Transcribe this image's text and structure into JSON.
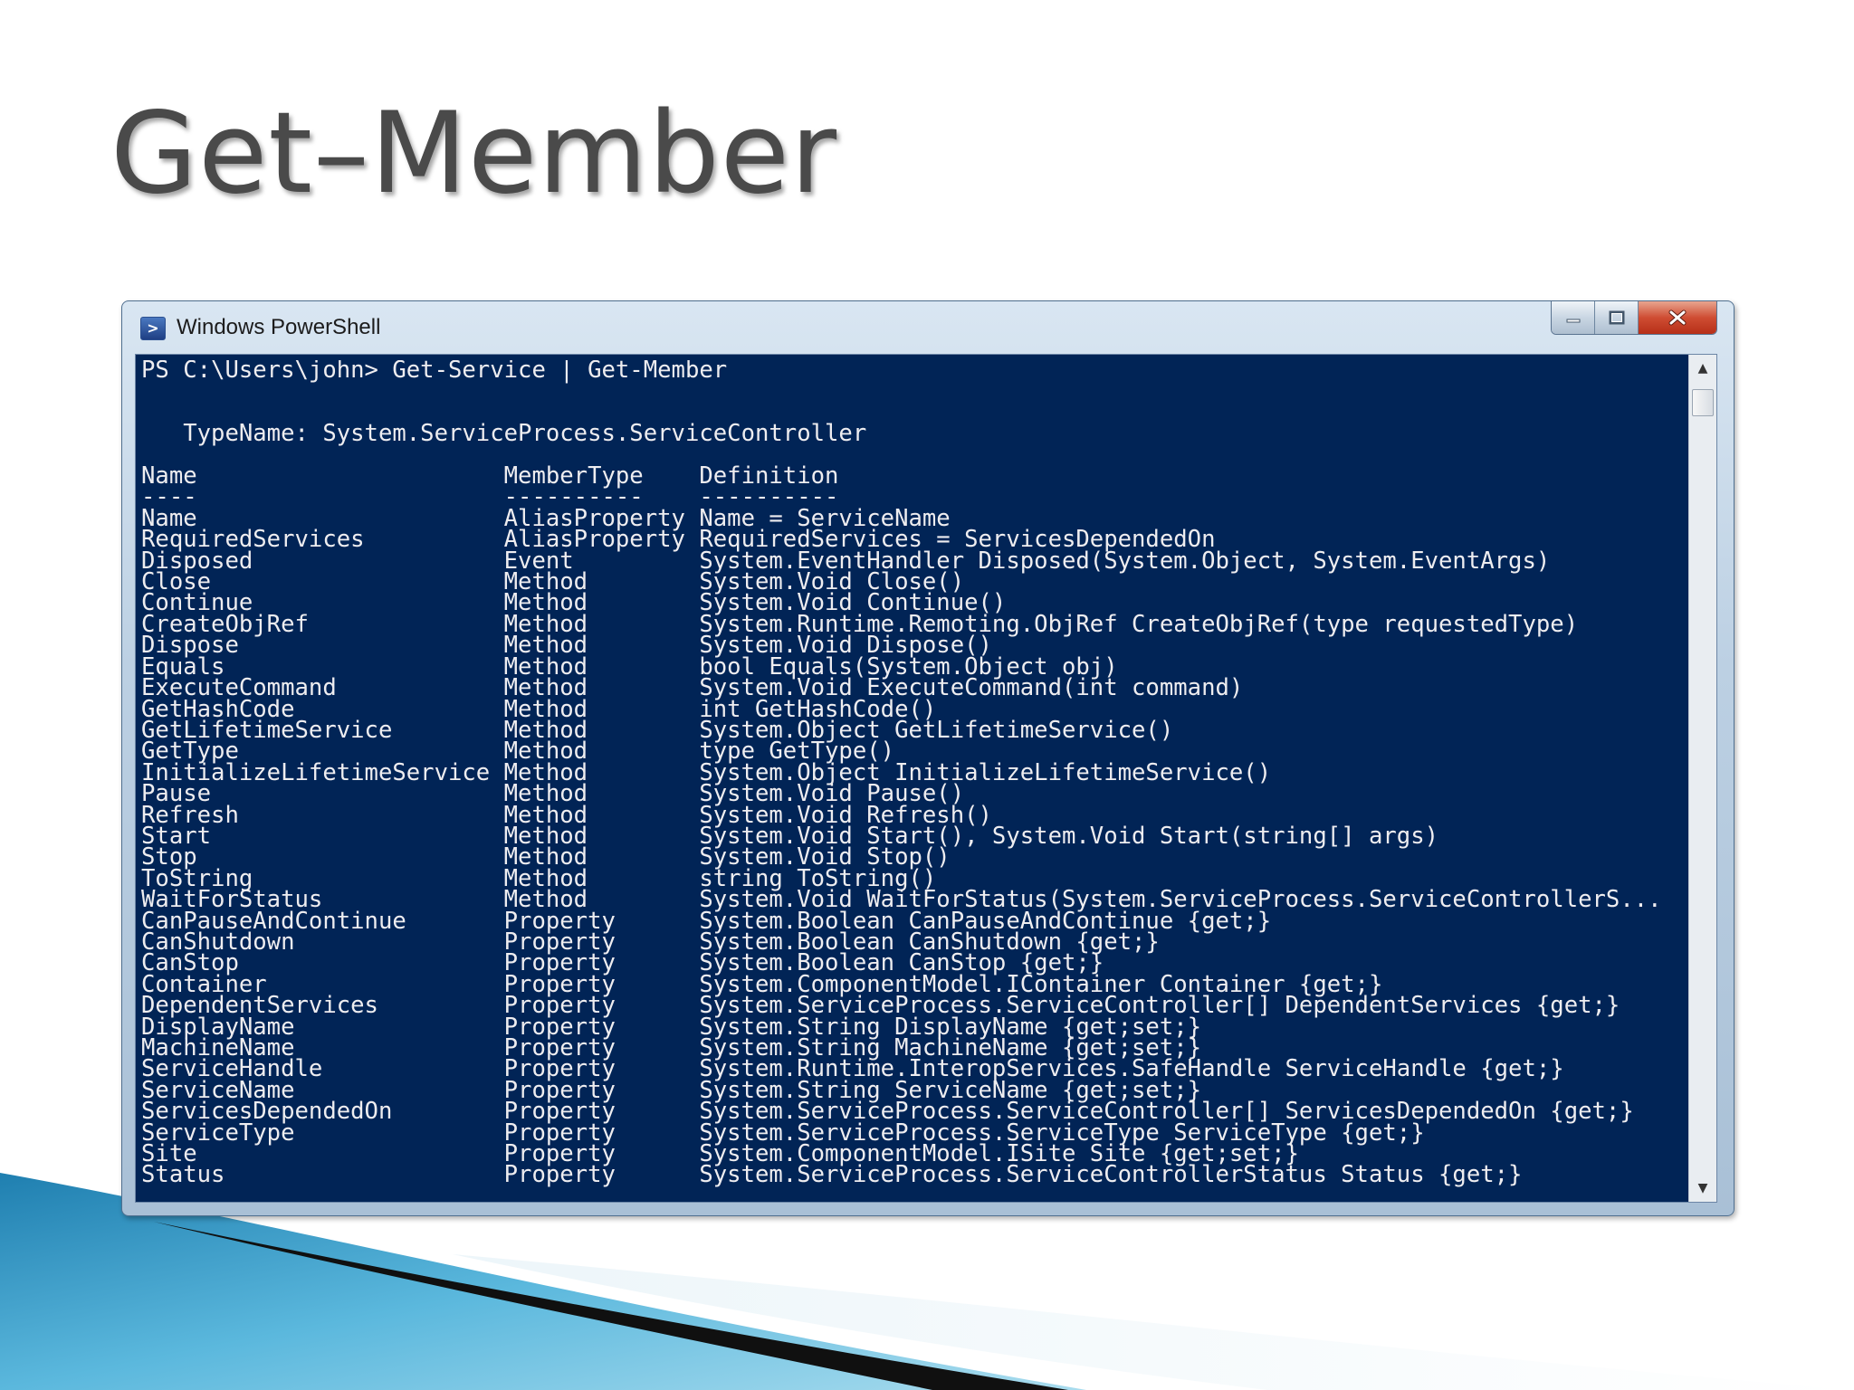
{
  "slide": {
    "title": "Get–Member"
  },
  "window": {
    "title": "Windows PowerShell",
    "icon_glyph": ">",
    "buttons": {
      "minimize": "–",
      "maximize": "□",
      "close": "x"
    }
  },
  "console": {
    "command_line": "PS C:\\Users\\john> Get-Service | Get-Member",
    "typename_line": "   TypeName: System.ServiceProcess.ServiceController",
    "columns": [
      "Name",
      "MemberType",
      "Definition"
    ],
    "rows": [
      [
        "Name",
        "AliasProperty",
        "Name = ServiceName"
      ],
      [
        "RequiredServices",
        "AliasProperty",
        "RequiredServices = ServicesDependedOn"
      ],
      [
        "Disposed",
        "Event",
        "System.EventHandler Disposed(System.Object, System.EventArgs)"
      ],
      [
        "Close",
        "Method",
        "System.Void Close()"
      ],
      [
        "Continue",
        "Method",
        "System.Void Continue()"
      ],
      [
        "CreateObjRef",
        "Method",
        "System.Runtime.Remoting.ObjRef CreateObjRef(type requestedType)"
      ],
      [
        "Dispose",
        "Method",
        "System.Void Dispose()"
      ],
      [
        "Equals",
        "Method",
        "bool Equals(System.Object obj)"
      ],
      [
        "ExecuteCommand",
        "Method",
        "System.Void ExecuteCommand(int command)"
      ],
      [
        "GetHashCode",
        "Method",
        "int GetHashCode()"
      ],
      [
        "GetLifetimeService",
        "Method",
        "System.Object GetLifetimeService()"
      ],
      [
        "GetType",
        "Method",
        "type GetType()"
      ],
      [
        "InitializeLifetimeService",
        "Method",
        "System.Object InitializeLifetimeService()"
      ],
      [
        "Pause",
        "Method",
        "System.Void Pause()"
      ],
      [
        "Refresh",
        "Method",
        "System.Void Refresh()"
      ],
      [
        "Start",
        "Method",
        "System.Void Start(), System.Void Start(string[] args)"
      ],
      [
        "Stop",
        "Method",
        "System.Void Stop()"
      ],
      [
        "ToString",
        "Method",
        "string ToString()"
      ],
      [
        "WaitForStatus",
        "Method",
        "System.Void WaitForStatus(System.ServiceProcess.ServiceControllerS..."
      ],
      [
        "CanPauseAndContinue",
        "Property",
        "System.Boolean CanPauseAndContinue {get;}"
      ],
      [
        "CanShutdown",
        "Property",
        "System.Boolean CanShutdown {get;}"
      ],
      [
        "CanStop",
        "Property",
        "System.Boolean CanStop {get;}"
      ],
      [
        "Container",
        "Property",
        "System.ComponentModel.IContainer Container {get;}"
      ],
      [
        "DependentServices",
        "Property",
        "System.ServiceProcess.ServiceController[] DependentServices {get;}"
      ],
      [
        "DisplayName",
        "Property",
        "System.String DisplayName {get;set;}"
      ],
      [
        "MachineName",
        "Property",
        "System.String MachineName {get;set;}"
      ],
      [
        "ServiceHandle",
        "Property",
        "System.Runtime.InteropServices.SafeHandle ServiceHandle {get;}"
      ],
      [
        "ServiceName",
        "Property",
        "System.String ServiceName {get;set;}"
      ],
      [
        "ServicesDependedOn",
        "Property",
        "System.ServiceProcess.ServiceController[] ServicesDependedOn {get;}"
      ],
      [
        "ServiceType",
        "Property",
        "System.ServiceProcess.ServiceType ServiceType {get;}"
      ],
      [
        "Site",
        "Property",
        "System.ComponentModel.ISite Site {get;set;}"
      ],
      [
        "Status",
        "Property",
        "System.ServiceProcess.ServiceControllerStatus Status {get;}"
      ]
    ]
  },
  "scrollbar": {
    "up_arrow": "▲",
    "down_arrow": "▼"
  },
  "colors": {
    "console_background": "#012456",
    "console_foreground": "#eeedf0",
    "title_text": "#4a4a4a"
  }
}
